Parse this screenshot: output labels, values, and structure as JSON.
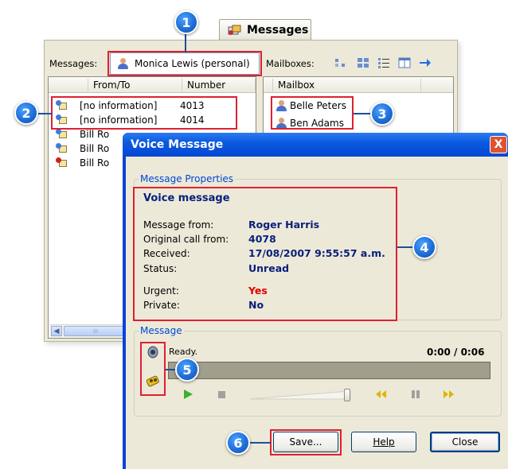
{
  "back_window": {
    "tab_label": "Messages",
    "messages_label": "Messages:",
    "selected_user": "Monica Lewis (personal)",
    "mailboxes_label": "Mailboxes:",
    "message_list": {
      "columns": [
        "From/To",
        "Number"
      ],
      "rows": [
        {
          "from": "[no information]",
          "number": "4013",
          "icon_color": "#3c7be0"
        },
        {
          "from": "[no information]",
          "number": "4014",
          "icon_color": "#3c7be0"
        },
        {
          "from": "Bill Ro",
          "number": "",
          "icon_color": "#3c7be0"
        },
        {
          "from": "Bill Ro",
          "number": "",
          "icon_color": "#3c7be0"
        },
        {
          "from": "Bill Ro",
          "number": "",
          "icon_color": "#d02020"
        }
      ]
    },
    "mailbox_list": {
      "column": "Mailbox",
      "rows": [
        "Belle Peters",
        "Ben Adams"
      ]
    },
    "scroll_glyph": "III"
  },
  "dialog": {
    "title": "Voice Message",
    "close_glyph": "X",
    "properties_group": "Message Properties",
    "heading": "Voice message",
    "properties": [
      {
        "label": "Message from:",
        "value": "Roger Harris",
        "red": false
      },
      {
        "label": "Original call from:",
        "value": "4078",
        "red": false
      },
      {
        "label": "Received:",
        "value": "17/08/2007 9:55:57 a.m.",
        "red": false
      },
      {
        "label": "Status:",
        "value": "Unread",
        "red": false
      },
      {
        "label": "Urgent:",
        "value": "Yes",
        "red": true
      },
      {
        "label": "Private:",
        "value": "No",
        "red": false
      }
    ],
    "message_group": "Message",
    "player_status": "Ready.",
    "player_time": "0:00 / 0:06",
    "volume_level": 0.97,
    "buttons": {
      "save": "Save...",
      "help": "Help",
      "close": "Close"
    }
  },
  "callouts": [
    "1",
    "2",
    "3",
    "4",
    "5",
    "6"
  ]
}
